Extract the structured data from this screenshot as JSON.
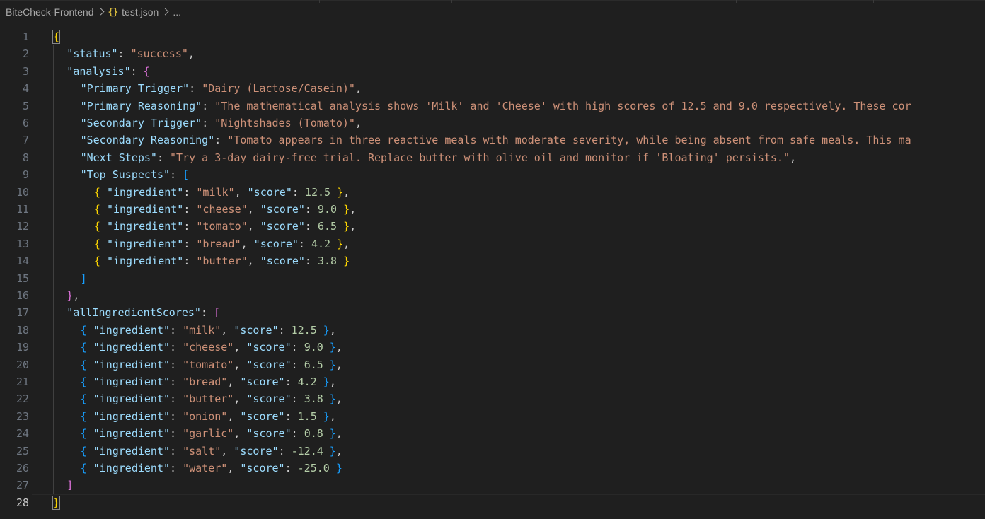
{
  "breadcrumb": {
    "folder": "BiteCheck-Frontend",
    "file_icon": "{}",
    "file": "test.json",
    "ellipsis": "..."
  },
  "editor": {
    "active_line": 28,
    "lines": [
      {
        "n": "1",
        "indent": 0,
        "tokens": [
          {
            "t": "b1",
            "v": "{"
          }
        ]
      },
      {
        "n": "2",
        "indent": 1,
        "tokens": [
          {
            "t": "k",
            "v": "\"status\""
          },
          {
            "t": "p",
            "v": ": "
          },
          {
            "t": "s",
            "v": "\"success\""
          },
          {
            "t": "p",
            "v": ","
          }
        ]
      },
      {
        "n": "3",
        "indent": 1,
        "tokens": [
          {
            "t": "k",
            "v": "\"analysis\""
          },
          {
            "t": "p",
            "v": ": "
          },
          {
            "t": "b2",
            "v": "{"
          }
        ]
      },
      {
        "n": "4",
        "indent": 2,
        "tokens": [
          {
            "t": "k",
            "v": "\"Primary Trigger\""
          },
          {
            "t": "p",
            "v": ": "
          },
          {
            "t": "s",
            "v": "\"Dairy (Lactose/Casein)\""
          },
          {
            "t": "p",
            "v": ","
          }
        ]
      },
      {
        "n": "5",
        "indent": 2,
        "tokens": [
          {
            "t": "k",
            "v": "\"Primary Reasoning\""
          },
          {
            "t": "p",
            "v": ": "
          },
          {
            "t": "s",
            "v": "\"The mathematical analysis shows 'Milk' and 'Cheese' with high scores of 12.5 and 9.0 respectively. These cor"
          }
        ]
      },
      {
        "n": "6",
        "indent": 2,
        "tokens": [
          {
            "t": "k",
            "v": "\"Secondary Trigger\""
          },
          {
            "t": "p",
            "v": ": "
          },
          {
            "t": "s",
            "v": "\"Nightshades (Tomato)\""
          },
          {
            "t": "p",
            "v": ","
          }
        ]
      },
      {
        "n": "7",
        "indent": 2,
        "tokens": [
          {
            "t": "k",
            "v": "\"Secondary Reasoning\""
          },
          {
            "t": "p",
            "v": ": "
          },
          {
            "t": "s",
            "v": "\"Tomato appears in three reactive meals with moderate severity, while being absent from safe meals. This ma"
          }
        ]
      },
      {
        "n": "8",
        "indent": 2,
        "tokens": [
          {
            "t": "k",
            "v": "\"Next Steps\""
          },
          {
            "t": "p",
            "v": ": "
          },
          {
            "t": "s",
            "v": "\"Try a 3-day dairy-free trial. Replace butter with olive oil and monitor if 'Bloating' persists.\""
          },
          {
            "t": "p",
            "v": ","
          }
        ]
      },
      {
        "n": "9",
        "indent": 2,
        "tokens": [
          {
            "t": "k",
            "v": "\"Top Suspects\""
          },
          {
            "t": "p",
            "v": ": "
          },
          {
            "t": "b3",
            "v": "["
          }
        ]
      },
      {
        "n": "10",
        "indent": 3,
        "tokens": [
          {
            "t": "b1",
            "v": "{ "
          },
          {
            "t": "k",
            "v": "\"ingredient\""
          },
          {
            "t": "p",
            "v": ": "
          },
          {
            "t": "s",
            "v": "\"milk\""
          },
          {
            "t": "p",
            "v": ", "
          },
          {
            "t": "k",
            "v": "\"score\""
          },
          {
            "t": "p",
            "v": ": "
          },
          {
            "t": "n",
            "v": "12.5"
          },
          {
            "t": "b1",
            "v": " }"
          },
          {
            "t": "p",
            "v": ","
          }
        ]
      },
      {
        "n": "11",
        "indent": 3,
        "tokens": [
          {
            "t": "b1",
            "v": "{ "
          },
          {
            "t": "k",
            "v": "\"ingredient\""
          },
          {
            "t": "p",
            "v": ": "
          },
          {
            "t": "s",
            "v": "\"cheese\""
          },
          {
            "t": "p",
            "v": ", "
          },
          {
            "t": "k",
            "v": "\"score\""
          },
          {
            "t": "p",
            "v": ": "
          },
          {
            "t": "n",
            "v": "9.0"
          },
          {
            "t": "b1",
            "v": " }"
          },
          {
            "t": "p",
            "v": ","
          }
        ]
      },
      {
        "n": "12",
        "indent": 3,
        "tokens": [
          {
            "t": "b1",
            "v": "{ "
          },
          {
            "t": "k",
            "v": "\"ingredient\""
          },
          {
            "t": "p",
            "v": ": "
          },
          {
            "t": "s",
            "v": "\"tomato\""
          },
          {
            "t": "p",
            "v": ", "
          },
          {
            "t": "k",
            "v": "\"score\""
          },
          {
            "t": "p",
            "v": ": "
          },
          {
            "t": "n",
            "v": "6.5"
          },
          {
            "t": "b1",
            "v": " }"
          },
          {
            "t": "p",
            "v": ","
          }
        ]
      },
      {
        "n": "13",
        "indent": 3,
        "tokens": [
          {
            "t": "b1",
            "v": "{ "
          },
          {
            "t": "k",
            "v": "\"ingredient\""
          },
          {
            "t": "p",
            "v": ": "
          },
          {
            "t": "s",
            "v": "\"bread\""
          },
          {
            "t": "p",
            "v": ", "
          },
          {
            "t": "k",
            "v": "\"score\""
          },
          {
            "t": "p",
            "v": ": "
          },
          {
            "t": "n",
            "v": "4.2"
          },
          {
            "t": "b1",
            "v": " }"
          },
          {
            "t": "p",
            "v": ","
          }
        ]
      },
      {
        "n": "14",
        "indent": 3,
        "tokens": [
          {
            "t": "b1",
            "v": "{ "
          },
          {
            "t": "k",
            "v": "\"ingredient\""
          },
          {
            "t": "p",
            "v": ": "
          },
          {
            "t": "s",
            "v": "\"butter\""
          },
          {
            "t": "p",
            "v": ", "
          },
          {
            "t": "k",
            "v": "\"score\""
          },
          {
            "t": "p",
            "v": ": "
          },
          {
            "t": "n",
            "v": "3.8"
          },
          {
            "t": "b1",
            "v": " }"
          }
        ]
      },
      {
        "n": "15",
        "indent": 2,
        "tokens": [
          {
            "t": "b3",
            "v": "]"
          }
        ]
      },
      {
        "n": "16",
        "indent": 1,
        "tokens": [
          {
            "t": "b2",
            "v": "}"
          },
          {
            "t": "p",
            "v": ","
          }
        ]
      },
      {
        "n": "17",
        "indent": 1,
        "tokens": [
          {
            "t": "k",
            "v": "\"allIngredientScores\""
          },
          {
            "t": "p",
            "v": ": "
          },
          {
            "t": "b2",
            "v": "["
          }
        ]
      },
      {
        "n": "18",
        "indent": 2,
        "tokens": [
          {
            "t": "b3",
            "v": "{ "
          },
          {
            "t": "k",
            "v": "\"ingredient\""
          },
          {
            "t": "p",
            "v": ": "
          },
          {
            "t": "s",
            "v": "\"milk\""
          },
          {
            "t": "p",
            "v": ", "
          },
          {
            "t": "k",
            "v": "\"score\""
          },
          {
            "t": "p",
            "v": ": "
          },
          {
            "t": "n",
            "v": "12.5"
          },
          {
            "t": "b3",
            "v": " }"
          },
          {
            "t": "p",
            "v": ","
          }
        ]
      },
      {
        "n": "19",
        "indent": 2,
        "tokens": [
          {
            "t": "b3",
            "v": "{ "
          },
          {
            "t": "k",
            "v": "\"ingredient\""
          },
          {
            "t": "p",
            "v": ": "
          },
          {
            "t": "s",
            "v": "\"cheese\""
          },
          {
            "t": "p",
            "v": ", "
          },
          {
            "t": "k",
            "v": "\"score\""
          },
          {
            "t": "p",
            "v": ": "
          },
          {
            "t": "n",
            "v": "9.0"
          },
          {
            "t": "b3",
            "v": " }"
          },
          {
            "t": "p",
            "v": ","
          }
        ]
      },
      {
        "n": "20",
        "indent": 2,
        "tokens": [
          {
            "t": "b3",
            "v": "{ "
          },
          {
            "t": "k",
            "v": "\"ingredient\""
          },
          {
            "t": "p",
            "v": ": "
          },
          {
            "t": "s",
            "v": "\"tomato\""
          },
          {
            "t": "p",
            "v": ", "
          },
          {
            "t": "k",
            "v": "\"score\""
          },
          {
            "t": "p",
            "v": ": "
          },
          {
            "t": "n",
            "v": "6.5"
          },
          {
            "t": "b3",
            "v": " }"
          },
          {
            "t": "p",
            "v": ","
          }
        ]
      },
      {
        "n": "21",
        "indent": 2,
        "tokens": [
          {
            "t": "b3",
            "v": "{ "
          },
          {
            "t": "k",
            "v": "\"ingredient\""
          },
          {
            "t": "p",
            "v": ": "
          },
          {
            "t": "s",
            "v": "\"bread\""
          },
          {
            "t": "p",
            "v": ", "
          },
          {
            "t": "k",
            "v": "\"score\""
          },
          {
            "t": "p",
            "v": ": "
          },
          {
            "t": "n",
            "v": "4.2"
          },
          {
            "t": "b3",
            "v": " }"
          },
          {
            "t": "p",
            "v": ","
          }
        ]
      },
      {
        "n": "22",
        "indent": 2,
        "tokens": [
          {
            "t": "b3",
            "v": "{ "
          },
          {
            "t": "k",
            "v": "\"ingredient\""
          },
          {
            "t": "p",
            "v": ": "
          },
          {
            "t": "s",
            "v": "\"butter\""
          },
          {
            "t": "p",
            "v": ", "
          },
          {
            "t": "k",
            "v": "\"score\""
          },
          {
            "t": "p",
            "v": ": "
          },
          {
            "t": "n",
            "v": "3.8"
          },
          {
            "t": "b3",
            "v": " }"
          },
          {
            "t": "p",
            "v": ","
          }
        ]
      },
      {
        "n": "23",
        "indent": 2,
        "tokens": [
          {
            "t": "b3",
            "v": "{ "
          },
          {
            "t": "k",
            "v": "\"ingredient\""
          },
          {
            "t": "p",
            "v": ": "
          },
          {
            "t": "s",
            "v": "\"onion\""
          },
          {
            "t": "p",
            "v": ", "
          },
          {
            "t": "k",
            "v": "\"score\""
          },
          {
            "t": "p",
            "v": ": "
          },
          {
            "t": "n",
            "v": "1.5"
          },
          {
            "t": "b3",
            "v": " }"
          },
          {
            "t": "p",
            "v": ","
          }
        ]
      },
      {
        "n": "24",
        "indent": 2,
        "tokens": [
          {
            "t": "b3",
            "v": "{ "
          },
          {
            "t": "k",
            "v": "\"ingredient\""
          },
          {
            "t": "p",
            "v": ": "
          },
          {
            "t": "s",
            "v": "\"garlic\""
          },
          {
            "t": "p",
            "v": ", "
          },
          {
            "t": "k",
            "v": "\"score\""
          },
          {
            "t": "p",
            "v": ": "
          },
          {
            "t": "n",
            "v": "0.8"
          },
          {
            "t": "b3",
            "v": " }"
          },
          {
            "t": "p",
            "v": ","
          }
        ]
      },
      {
        "n": "25",
        "indent": 2,
        "tokens": [
          {
            "t": "b3",
            "v": "{ "
          },
          {
            "t": "k",
            "v": "\"ingredient\""
          },
          {
            "t": "p",
            "v": ": "
          },
          {
            "t": "s",
            "v": "\"salt\""
          },
          {
            "t": "p",
            "v": ", "
          },
          {
            "t": "k",
            "v": "\"score\""
          },
          {
            "t": "p",
            "v": ": "
          },
          {
            "t": "n",
            "v": "-12.4"
          },
          {
            "t": "b3",
            "v": " }"
          },
          {
            "t": "p",
            "v": ","
          }
        ]
      },
      {
        "n": "26",
        "indent": 2,
        "tokens": [
          {
            "t": "b3",
            "v": "{ "
          },
          {
            "t": "k",
            "v": "\"ingredient\""
          },
          {
            "t": "p",
            "v": ": "
          },
          {
            "t": "s",
            "v": "\"water\""
          },
          {
            "t": "p",
            "v": ", "
          },
          {
            "t": "k",
            "v": "\"score\""
          },
          {
            "t": "p",
            "v": ": "
          },
          {
            "t": "n",
            "v": "-25.0"
          },
          {
            "t": "b3",
            "v": " }"
          }
        ]
      },
      {
        "n": "27",
        "indent": 1,
        "tokens": [
          {
            "t": "b2",
            "v": "]"
          }
        ]
      },
      {
        "n": "28",
        "indent": 0,
        "tokens": [
          {
            "t": "b1",
            "v": "}"
          }
        ]
      }
    ]
  }
}
